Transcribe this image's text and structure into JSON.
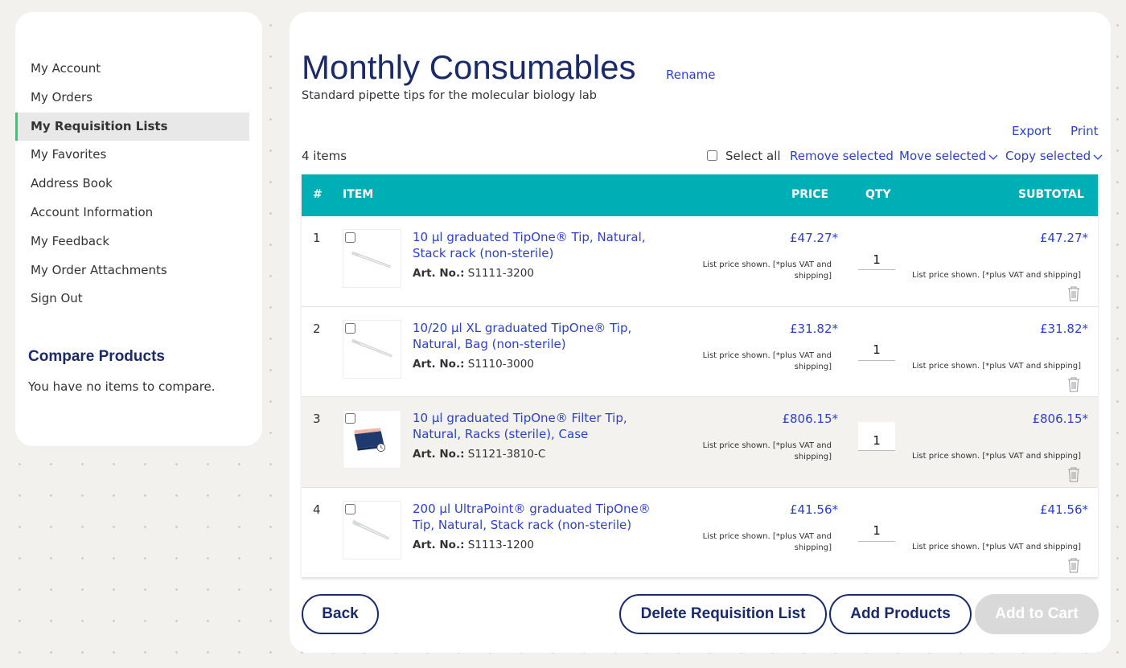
{
  "sidebar": {
    "nav": [
      {
        "label": "My Account",
        "active": false
      },
      {
        "label": "My Orders",
        "active": false
      },
      {
        "label": "My Requisition Lists",
        "active": true
      },
      {
        "label": "My Favorites",
        "active": false
      },
      {
        "label": "Address Book",
        "active": false
      },
      {
        "label": "Account Information",
        "active": false
      },
      {
        "label": "My Feedback",
        "active": false
      },
      {
        "label": "My Order Attachments",
        "active": false
      },
      {
        "label": "Sign Out",
        "active": false
      }
    ],
    "compare": {
      "title": "Compare Products",
      "text": "You have no items to compare."
    }
  },
  "main": {
    "title": "Monthly Consumables",
    "rename": "Rename",
    "subtitle": "Standard pipette tips for the molecular biology lab",
    "export": "Export",
    "print": "Print",
    "item_count": "4 items",
    "select_all": "Select all",
    "remove_selected": "Remove selected",
    "move_selected": "Move selected",
    "copy_selected": "Copy selected",
    "columns": {
      "num": "#",
      "item": "ITEM",
      "price": "PRICE",
      "qty": "QTY",
      "subtotal": "SUBTOTAL"
    },
    "art_label": "Art. No.:",
    "price_note": "List price shown. [*plus VAT and shipping]",
    "rows": [
      {
        "num": "1",
        "name": "10 µl graduated TipOne® Tip, Natural, Stack rack (non-sterile)",
        "art_no": "S1111-3200",
        "price": "£47.27*",
        "qty": "1",
        "subtotal": "£47.27*",
        "thumb": "pipette-tip-icon"
      },
      {
        "num": "2",
        "name": "10/20 µl XL graduated TipOne® Tip, Natural, Bag (non-sterile)",
        "art_no": "S1110-3000",
        "price": "£31.82*",
        "qty": "1",
        "subtotal": "£31.82*",
        "thumb": "pipette-tip-icon"
      },
      {
        "num": "3",
        "name": "10 µl graduated TipOne® Filter Tip, Natural, Racks (sterile), Case",
        "art_no": "S1121-3810-C",
        "price": "£806.15*",
        "qty": "1",
        "subtotal": "£806.15*",
        "thumb": "tip-rack-box-icon"
      },
      {
        "num": "4",
        "name": "200 µl UltraPoint® graduated TipOne® Tip, Natural, Stack rack (non-sterile)",
        "art_no": "S1113-1200",
        "price": "£41.56*",
        "qty": "1",
        "subtotal": "£41.56*",
        "thumb": "pipette-tip-icon"
      }
    ],
    "buttons": {
      "back": "Back",
      "delete": "Delete Requisition List",
      "add_products": "Add Products",
      "add_to_cart": "Add to Cart"
    }
  },
  "colors": {
    "brand_navy": "#1b2a6b",
    "link_blue": "#2b3fd6",
    "table_header": "#00aeb5",
    "active_nav_bar": "#2ecc71",
    "disabled_button": "#d9d9d9"
  }
}
